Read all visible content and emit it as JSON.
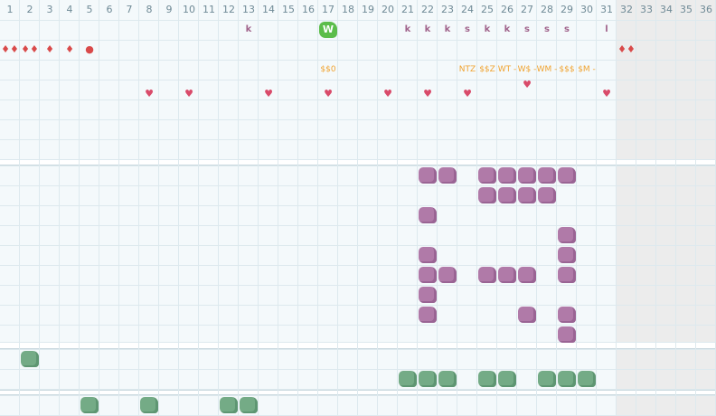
{
  "days": [
    "1",
    "2",
    "3",
    "4",
    "5",
    "6",
    "7",
    "8",
    "9",
    "10",
    "11",
    "12",
    "13",
    "14",
    "15",
    "16",
    "17",
    "18",
    "19",
    "20",
    "21",
    "22",
    "23",
    "24",
    "25",
    "26",
    "27",
    "28",
    "29",
    "30",
    "31",
    "32",
    "33",
    "34",
    "35",
    "36"
  ],
  "letter_marks": [
    {
      "day": 13,
      "text": "k"
    },
    {
      "day": 21,
      "text": "k"
    },
    {
      "day": 22,
      "text": "k"
    },
    {
      "day": 23,
      "text": "k"
    },
    {
      "day": 24,
      "text": "s"
    },
    {
      "day": 25,
      "text": "k"
    },
    {
      "day": 26,
      "text": "k"
    },
    {
      "day": 27,
      "text": "s"
    },
    {
      "day": 28,
      "text": "s"
    },
    {
      "day": 29,
      "text": "s"
    },
    {
      "day": 31,
      "text": "l"
    }
  ],
  "w_badge": {
    "day": 17,
    "text": "W"
  },
  "drops": [
    {
      "day": 1,
      "text": "♦♦"
    },
    {
      "day": 2,
      "text": "♦♦"
    },
    {
      "day": 3,
      "text": "♦"
    },
    {
      "day": 4,
      "text": "♦"
    },
    {
      "day": 5,
      "text": "●"
    },
    {
      "day": 32,
      "text": "♦♦"
    }
  ],
  "money_marks": [
    {
      "day": 17,
      "text": "$$0"
    },
    {
      "day": 24,
      "text": "NTZ"
    },
    {
      "day": 25,
      "text": "$$Z"
    },
    {
      "day": 26,
      "text": "WT -"
    },
    {
      "day": 27,
      "text": "W$ -"
    },
    {
      "day": 28,
      "text": "WM -"
    },
    {
      "day": 29,
      "text": "$$$"
    },
    {
      "day": 30,
      "text": "$M -"
    }
  ],
  "hearts": [
    {
      "day": 8,
      "row": 0
    },
    {
      "day": 10,
      "row": 0
    },
    {
      "day": 14,
      "row": 0
    },
    {
      "day": 17,
      "row": 0
    },
    {
      "day": 20,
      "row": 0
    },
    {
      "day": 22,
      "row": 0
    },
    {
      "day": 24,
      "row": 0
    },
    {
      "day": 27,
      "row": -1
    },
    {
      "day": 31,
      "row": 0
    }
  ],
  "heart_glyph": "♥",
  "purple_blobs": [
    [
      22,
      0
    ],
    [
      23,
      0
    ],
    [
      25,
      0
    ],
    [
      26,
      0
    ],
    [
      27,
      0
    ],
    [
      28,
      0
    ],
    [
      29,
      0
    ],
    [
      25,
      1
    ],
    [
      26,
      1
    ],
    [
      27,
      1
    ],
    [
      28,
      1
    ],
    [
      22,
      2
    ],
    [
      29,
      3
    ],
    [
      22,
      4
    ],
    [
      29,
      4
    ],
    [
      22,
      5
    ],
    [
      23,
      5
    ],
    [
      25,
      5
    ],
    [
      26,
      5
    ],
    [
      27,
      5
    ],
    [
      29,
      5
    ],
    [
      22,
      6
    ],
    [
      22,
      7
    ],
    [
      27,
      7
    ],
    [
      29,
      7
    ],
    [
      29,
      8
    ]
  ],
  "green_blobs_a": [
    [
      2,
      0
    ],
    [
      21,
      1
    ],
    [
      22,
      1
    ],
    [
      23,
      1
    ],
    [
      25,
      1
    ],
    [
      26,
      1
    ],
    [
      28,
      1
    ],
    [
      29,
      1
    ],
    [
      30,
      1
    ]
  ],
  "green_blobs_b": [
    [
      5,
      0
    ],
    [
      8,
      0
    ],
    [
      12,
      0
    ],
    [
      13,
      0
    ]
  ],
  "colors": {
    "purple": "#b07aa8",
    "green": "#74ab86",
    "badge": "#5bbd4a",
    "money": "#f0a330",
    "heart": "#d94b6a",
    "drop": "#d94a4a"
  }
}
